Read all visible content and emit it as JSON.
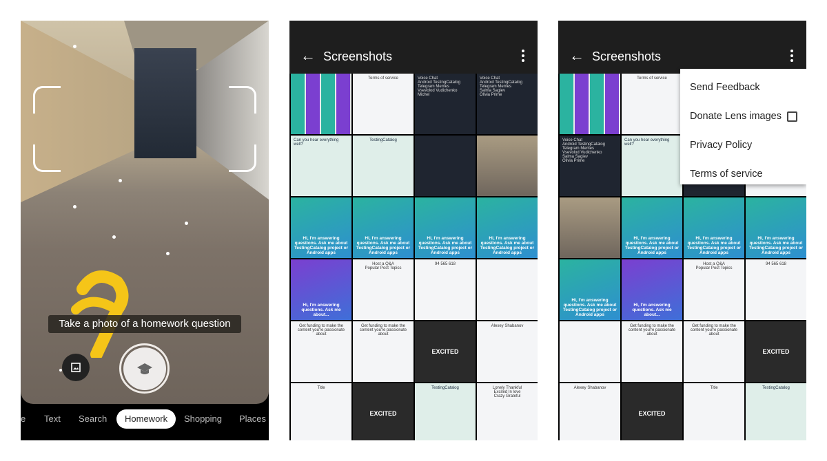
{
  "lens": {
    "hint": "Take a photo of a homework question",
    "modes": [
      "e",
      "Text",
      "Search",
      "Homework",
      "Shopping",
      "Places"
    ],
    "active_mode": "Homework",
    "icons": {
      "gallery": "image-icon",
      "shutter": "graduation-cap-icon"
    }
  },
  "gallery": {
    "title": "Screenshots",
    "thumbs": [
      {
        "kind": "collage"
      },
      {
        "kind": "white",
        "text": "Terms of service"
      },
      {
        "kind": "dark",
        "text": "Voice Chat\nAndroid TestingCatalog\nTelegram Memes\nVsevolod Vudichenko\nMichel"
      },
      {
        "kind": "dark",
        "text": "Voice Chat\nAndroid TestingCatalog\nTelegram Memes\nSalma Sagiev\nOlivia Prime"
      },
      {
        "kind": "chat",
        "text": "Can you hear everything well?"
      },
      {
        "kind": "chat",
        "text": "TestingCatalog"
      },
      {
        "kind": "dark",
        "text": ""
      },
      {
        "kind": "hall"
      },
      {
        "kind": "teal",
        "text": "Hi, I'm answering questions. Ask me about TestingCatalog project or Android apps"
      },
      {
        "kind": "teal",
        "text": "Hi, I'm answering questions. Ask me about TestingCatalog project or Android apps"
      },
      {
        "kind": "teal",
        "text": "Hi, I'm answering questions. Ask me about TestingCatalog project or Android apps"
      },
      {
        "kind": "teal",
        "text": "Hi, I'm answering questions. Ask me about TestingCatalog project or Android apps"
      },
      {
        "kind": "purple",
        "text": "Hi, I'm answering questions. Ask me about..."
      },
      {
        "kind": "white",
        "text": "Host a Q&A\nPopular Post Topics"
      },
      {
        "kind": "white",
        "text": "94  565  618"
      },
      {
        "kind": "white"
      },
      {
        "kind": "white",
        "text": "Get funding to make the content you're passionate about"
      },
      {
        "kind": "white",
        "text": "Get funding to make the content you're passionate about"
      },
      {
        "kind": "excited",
        "text": "EXCITED"
      },
      {
        "kind": "white",
        "text": "Alexey Shabanov"
      },
      {
        "kind": "white",
        "text": "Title"
      },
      {
        "kind": "excited",
        "text": "EXCITED"
      },
      {
        "kind": "chat",
        "text": "TestingCatalog"
      },
      {
        "kind": "white",
        "text": "Lonely  Thankful\nExcited  In love\nCrazy  Grateful"
      }
    ]
  },
  "gallery_menu": {
    "title": "Screenshots",
    "items": [
      "Send Feedback",
      "Donate Lens images",
      "Privacy Policy",
      "Terms of service"
    ],
    "donate_checked": false,
    "thumbs": [
      {
        "kind": "collage"
      },
      {
        "kind": "white",
        "text": "Terms of service"
      },
      {
        "kind": "collage"
      },
      {
        "kind": "white"
      },
      {
        "kind": "dark",
        "text": "Voice Chat\nAndroid TestingCatalog\nTelegram Memes\nVsevolod Vudichenko\nSalma Sagiev\nOlivia Prime"
      },
      {
        "kind": "chat",
        "text": "Can you hear everything well?"
      },
      {
        "kind": "dark"
      },
      {
        "kind": "white"
      },
      {
        "kind": "hall"
      },
      {
        "kind": "teal",
        "text": "Hi, I'm answering questions. Ask me about TestingCatalog project or Android apps"
      },
      {
        "kind": "teal",
        "text": "Hi, I'm answering questions. Ask me about TestingCatalog project or Android apps"
      },
      {
        "kind": "teal",
        "text": "Hi, I'm answering questions. Ask me about TestingCatalog project or Android apps"
      },
      {
        "kind": "teal",
        "text": "Hi, I'm answering questions. Ask me about TestingCatalog project or Android apps"
      },
      {
        "kind": "purple",
        "text": "Hi, I'm answering questions. Ask me about..."
      },
      {
        "kind": "white",
        "text": "Host a Q&A\nPopular Post Topics"
      },
      {
        "kind": "white",
        "text": "94  565  618"
      },
      {
        "kind": "white"
      },
      {
        "kind": "white",
        "text": "Get funding to make the content you're passionate about"
      },
      {
        "kind": "white",
        "text": "Get funding to make the content you're passionate about"
      },
      {
        "kind": "excited",
        "text": "EXCITED"
      },
      {
        "kind": "white",
        "text": "Alexey Shabanov"
      },
      {
        "kind": "excited",
        "text": "EXCITED"
      },
      {
        "kind": "white",
        "text": "Title"
      },
      {
        "kind": "chat",
        "text": "TestingCatalog"
      }
    ]
  }
}
